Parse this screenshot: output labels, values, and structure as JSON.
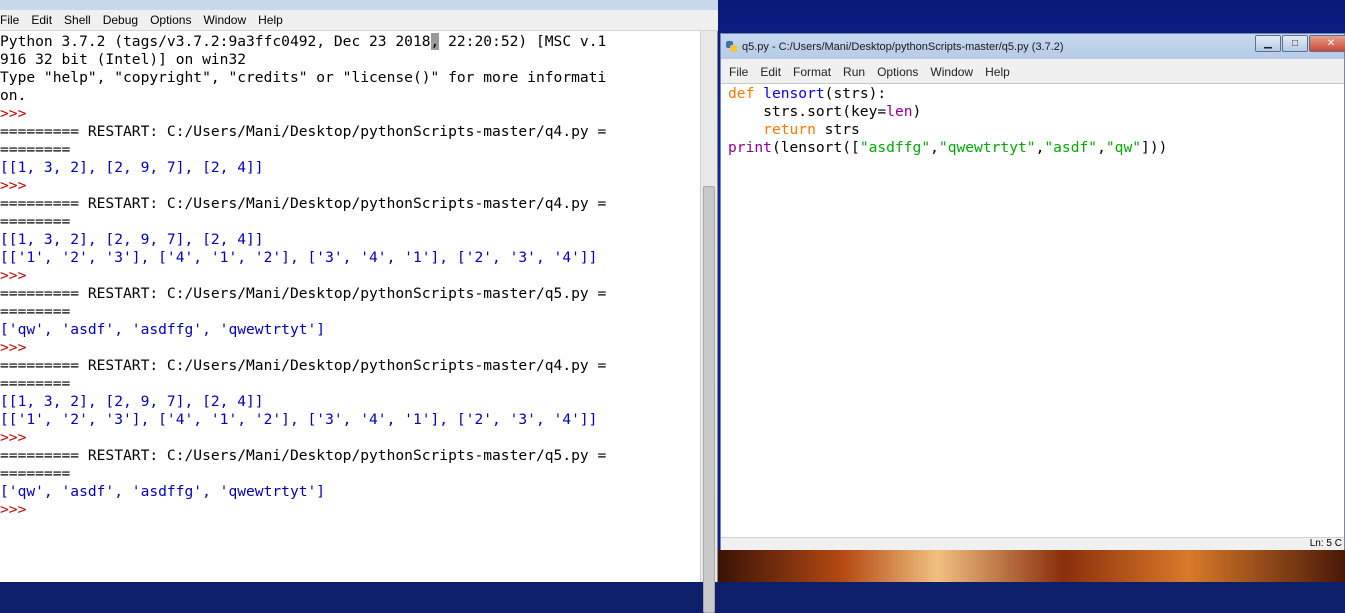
{
  "shell": {
    "menu": [
      "File",
      "Edit",
      "Shell",
      "Debug",
      "Options",
      "Window",
      "Help"
    ],
    "lines": [
      {
        "kind": "banner-cursor",
        "before": "Python 3.7.2 (tags/v3.7.2:9a3ffc0492, Dec 23 2018",
        "cursor": ",",
        "after": " 22:20:52) [MSC v.1"
      },
      {
        "kind": "banner",
        "text": "916 32 bit (Intel)] on win32"
      },
      {
        "kind": "banner",
        "text": "Type \"help\", \"copyright\", \"credits\" or \"license()\" for more informati"
      },
      {
        "kind": "banner",
        "text": "on."
      },
      {
        "kind": "prompt",
        "text": ">>> "
      },
      {
        "kind": "banner",
        "text": "========= RESTART: C:/Users/Mani/Desktop/pythonScripts-master/q4.py ="
      },
      {
        "kind": "banner",
        "text": "========"
      },
      {
        "kind": "out",
        "text": "[[1, 3, 2], [2, 9, 7], [2, 4]]"
      },
      {
        "kind": "prompt",
        "text": ">>> "
      },
      {
        "kind": "banner",
        "text": "========= RESTART: C:/Users/Mani/Desktop/pythonScripts-master/q4.py ="
      },
      {
        "kind": "banner",
        "text": "========"
      },
      {
        "kind": "out",
        "text": "[[1, 3, 2], [2, 9, 7], [2, 4]]"
      },
      {
        "kind": "out",
        "text": "[['1', '2', '3'], ['4', '1', '2'], ['3', '4', '1'], ['2', '3', '4']]"
      },
      {
        "kind": "prompt",
        "text": ">>> "
      },
      {
        "kind": "banner",
        "text": "========= RESTART: C:/Users/Mani/Desktop/pythonScripts-master/q5.py ="
      },
      {
        "kind": "banner",
        "text": "========"
      },
      {
        "kind": "out",
        "text": "['qw', 'asdf', 'asdffg', 'qwewtrtyt']"
      },
      {
        "kind": "prompt",
        "text": ">>> "
      },
      {
        "kind": "banner",
        "text": "========= RESTART: C:/Users/Mani/Desktop/pythonScripts-master/q4.py ="
      },
      {
        "kind": "banner",
        "text": "========"
      },
      {
        "kind": "out",
        "text": "[[1, 3, 2], [2, 9, 7], [2, 4]]"
      },
      {
        "kind": "out",
        "text": "[['1', '2', '3'], ['4', '1', '2'], ['3', '4', '1'], ['2', '3', '4']]"
      },
      {
        "kind": "prompt",
        "text": ">>> "
      },
      {
        "kind": "banner",
        "text": "========= RESTART: C:/Users/Mani/Desktop/pythonScripts-master/q5.py ="
      },
      {
        "kind": "banner",
        "text": "========"
      },
      {
        "kind": "out",
        "text": "['qw', 'asdf', 'asdffg', 'qwewtrtyt']"
      },
      {
        "kind": "prompt",
        "text": ">>> "
      }
    ]
  },
  "editor": {
    "title": "q5.py - C:/Users/Mani/Desktop/pythonScripts-master/q5.py (3.7.2)",
    "menu": [
      "File",
      "Edit",
      "Format",
      "Run",
      "Options",
      "Window",
      "Help"
    ],
    "controls": {
      "minimize": "▁",
      "maximize": "□",
      "close": "✕"
    },
    "code": [
      [
        {
          "c": "kw",
          "t": "def"
        },
        {
          "c": "",
          "t": " "
        },
        {
          "c": "fn",
          "t": "lensort"
        },
        {
          "c": "",
          "t": "(strs):"
        }
      ],
      [
        {
          "c": "",
          "t": "    strs.sort(key="
        },
        {
          "c": "bi",
          "t": "len"
        },
        {
          "c": "",
          "t": ")"
        }
      ],
      [
        {
          "c": "",
          "t": "    "
        },
        {
          "c": "kw",
          "t": "return"
        },
        {
          "c": "",
          "t": " strs"
        }
      ],
      [
        {
          "c": "bi",
          "t": "print"
        },
        {
          "c": "",
          "t": "(lensort(["
        },
        {
          "c": "st",
          "t": "\"asdffg\""
        },
        {
          "c": "",
          "t": ","
        },
        {
          "c": "st",
          "t": "\"qwewtrtyt\""
        },
        {
          "c": "",
          "t": ","
        },
        {
          "c": "st",
          "t": "\"asdf\""
        },
        {
          "c": "",
          "t": ","
        },
        {
          "c": "st",
          "t": "\"qw\""
        },
        {
          "c": "",
          "t": "]))"
        }
      ]
    ],
    "status": "Ln: 5   C"
  },
  "colors": {
    "output": "#0000c0",
    "prompt": "#c00000",
    "keyword": "#ff7700",
    "builtin": "#900090",
    "definition": "#0000ff",
    "string": "#00aa00"
  }
}
